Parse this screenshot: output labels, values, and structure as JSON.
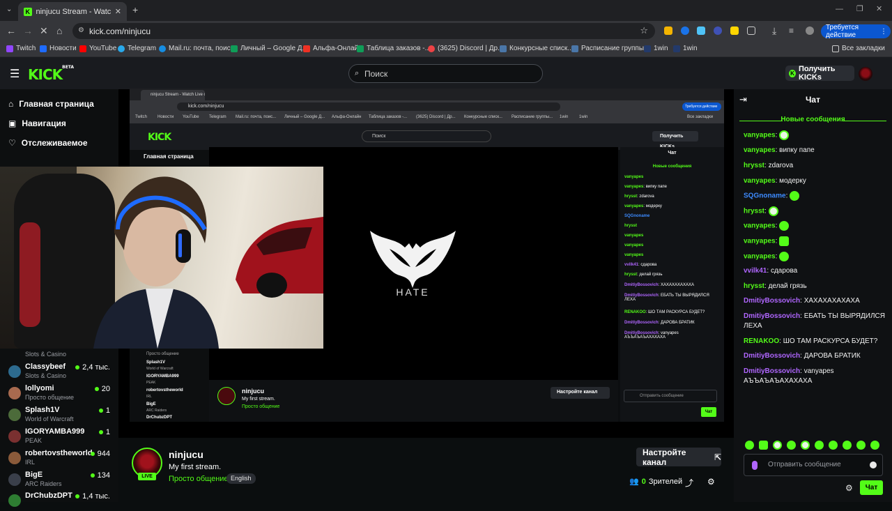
{
  "browser": {
    "tab_title": "ninjucu Stream - Watch Live on",
    "url": "kick.com/ninjucu",
    "action_button": "Требуется действие",
    "bookmarks": [
      "Twitch",
      "Новости",
      "YouTube",
      "Telegram",
      "Mail.ru: почта, поис...",
      "Личный – Google Д...",
      "Альфа-Онлайн",
      "Таблица заказов -...",
      "(3625) Discord | Др...",
      "Конкурсные списк...",
      "Расписание группы...",
      "1win",
      "1win"
    ],
    "all_bookmarks": "Все закладки"
  },
  "header": {
    "logo": "KICK",
    "logo_badge": "BETA",
    "search_placeholder": "Поиск",
    "get_kicks": "Получить KICKs"
  },
  "sidebar": {
    "nav": [
      {
        "label": "Главная страница",
        "icon": "home-icon"
      },
      {
        "label": "Навигация",
        "icon": "browse-icon"
      },
      {
        "label": "Отслеживаемое",
        "icon": "heart-icon"
      }
    ],
    "partial_top_category": "Slots & Casino",
    "channels": [
      {
        "name": "Classybeef",
        "category": "Slots & Casino",
        "viewers": "2,4 тыс."
      },
      {
        "name": "lollyomi",
        "category": "Просто общение",
        "viewers": "20"
      },
      {
        "name": "Splash1V",
        "category": "World of Warcraft",
        "viewers": "1"
      },
      {
        "name": "IGORYAMBA999",
        "category": "PEAK",
        "viewers": "1"
      },
      {
        "name": "robertovstheworld",
        "category": "IRL",
        "viewers": "944"
      },
      {
        "name": "BigE",
        "category": "ARC Raiders",
        "viewers": "134"
      },
      {
        "name": "DrChubzDPT",
        "category": "",
        "viewers": "1,4 тыс."
      }
    ]
  },
  "overlay": {
    "brand_text": "HATE"
  },
  "stream": {
    "channel": "ninjucu",
    "live_badge": "LIVE",
    "title": "My first stream.",
    "category": "Просто общение",
    "language": "English",
    "configure_button": "Настройте канал",
    "viewers_count": "0",
    "viewers_label": "Зрителей"
  },
  "chat": {
    "title": "Чат",
    "new_messages": "Новые сообщения",
    "messages": [
      {
        "user": "vanyapes",
        "color": "#53fc18",
        "text": "",
        "emote": "skull"
      },
      {
        "user": "vanyapes",
        "color": "#53fc18",
        "text": "випку папе"
      },
      {
        "user": "hrysst",
        "color": "#53fc18",
        "text": "zdarova"
      },
      {
        "user": "vanyapes",
        "color": "#53fc18",
        "text": "модерку"
      },
      {
        "user": "SQGnoname",
        "color": "#3d8bff",
        "text": "",
        "emote": "blob"
      },
      {
        "user": "hrysst",
        "color": "#53fc18",
        "text": "",
        "emote": "skull"
      },
      {
        "user": "vanyapes",
        "color": "#53fc18",
        "text": "",
        "emote": "blob"
      },
      {
        "user": "vanyapes",
        "color": "#53fc18",
        "text": "",
        "emote": "sq"
      },
      {
        "user": "vanyapes",
        "color": "#53fc18",
        "text": "",
        "emote": "blob"
      },
      {
        "user": "vvilk41",
        "color": "#b066ff",
        "text": "сдарова"
      },
      {
        "user": "hrysst",
        "color": "#53fc18",
        "text": "делай грязь"
      },
      {
        "user": "DmitiyBossovich",
        "color": "#b066ff",
        "text": "ХАХАХАХАХАХА"
      },
      {
        "user": "DmitiyBossovich",
        "color": "#b066ff",
        "text": "ЕБАТЬ ТЫ ВЫРЯДИЛСЯ ЛЕХА"
      },
      {
        "user": "RENAKOO",
        "color": "#53fc18",
        "text": "ШО ТАМ РАСКУРСА БУДЕТ?"
      },
      {
        "user": "DmitiyBossovich",
        "color": "#b066ff",
        "text": "ДАРОВА БРАТИК"
      },
      {
        "user": "DmitiyBossovich",
        "color": "#b066ff",
        "text": "vanyapes АЪЪАЪАЪАХАХАХА"
      }
    ],
    "input_placeholder": "Отправить сообщение",
    "send_button": "Чат"
  },
  "colors": {
    "accent": "#53fc18",
    "background": "#0b0e0f"
  }
}
